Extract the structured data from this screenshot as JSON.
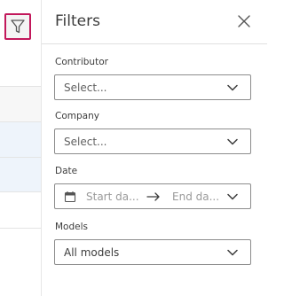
{
  "panel": {
    "title": "Filters",
    "close_icon": "close-icon"
  },
  "toolbar": {
    "filter_icon": "filter-funnel-icon",
    "accent": "#c2185b"
  },
  "fields": {
    "contributor": {
      "label": "Contributor",
      "placeholder": "Select..."
    },
    "company": {
      "label": "Company",
      "placeholder": "Select..."
    },
    "date": {
      "label": "Date",
      "start_placeholder": "Start da...",
      "end_placeholder": "End da..."
    },
    "models": {
      "label": "Models",
      "value": "All models"
    }
  }
}
